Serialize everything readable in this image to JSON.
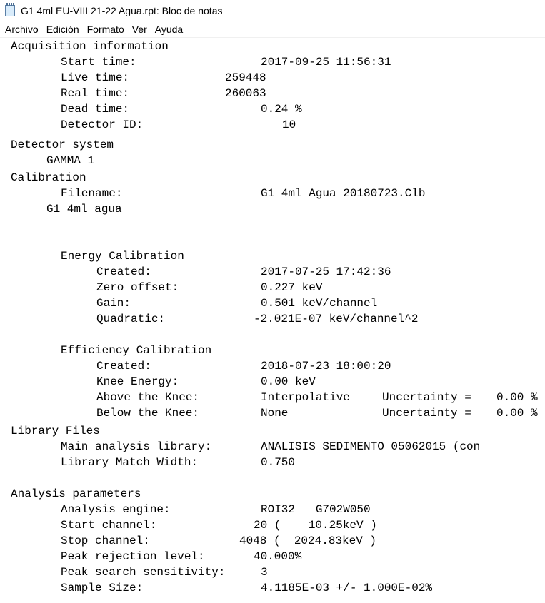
{
  "window": {
    "title": "G1 4ml EU-VIII 21-22 Agua.rpt: Bloc de notas"
  },
  "menu": [
    "Archivo",
    "Edición",
    "Formato",
    "Ver",
    "Ayuda"
  ],
  "report": {
    "acq": {
      "header": "Acquisition information",
      "start_time": [
        "Start time:",
        "2017-09-25 11:56:31"
      ],
      "live_time": [
        "Live time:",
        "259448"
      ],
      "real_time": [
        "Real time:",
        "260063"
      ],
      "dead_time": [
        "Dead time:",
        "0.24 %"
      ],
      "detector_id": [
        "Detector ID:",
        "10"
      ]
    },
    "detector": {
      "header": "Detector system",
      "name": "GAMMA 1"
    },
    "calibration": {
      "header": "Calibration",
      "filename": [
        "Filename:",
        "G1 4ml Agua 20180723.Clb"
      ],
      "description": "G1 4ml agua"
    },
    "energy": {
      "header": "Energy Calibration",
      "created": [
        "Created:",
        "2017-07-25 17:42:36"
      ],
      "zero_offset": [
        "Zero offset:",
        "0.227 keV"
      ],
      "gain": [
        "Gain:",
        "0.501 keV/channel"
      ],
      "quadratic": [
        "Quadratic:",
        "-2.021E-07 keV/channel^2"
      ]
    },
    "efficiency": {
      "header": "Efficiency Calibration",
      "created": [
        "Created:",
        "2018-07-23 18:00:20"
      ],
      "knee_energy": [
        "Knee Energy:",
        "0.00 keV"
      ],
      "above_knee": [
        "Above the Knee:",
        "Interpolative",
        "Uncertainty =",
        "0.00 %"
      ],
      "below_knee": [
        "Below the Knee:",
        "None",
        "Uncertainty =",
        "0.00 %"
      ]
    },
    "library": {
      "header": "Library Files",
      "main": [
        "Main analysis library:",
        "ANALISIS SEDIMENTO 05062015 (con"
      ],
      "match_width": [
        "Library Match Width:",
        "0.750"
      ]
    },
    "analysis": {
      "header": "Analysis parameters",
      "engine": [
        "Analysis engine:",
        "ROI32   G702W050"
      ],
      "start_channel": [
        "Start channel:",
        "20 (    10.25keV )"
      ],
      "stop_channel": [
        "Stop channel:",
        "4048 (  2024.83keV )"
      ],
      "peak_rejection": [
        "Peak rejection level:",
        "40.000%"
      ],
      "peak_search": [
        "Peak search sensitivity:",
        "3"
      ],
      "sample_size": [
        "Sample Size:",
        "4.1185E-03 +/- 1.000E-02%"
      ]
    }
  }
}
